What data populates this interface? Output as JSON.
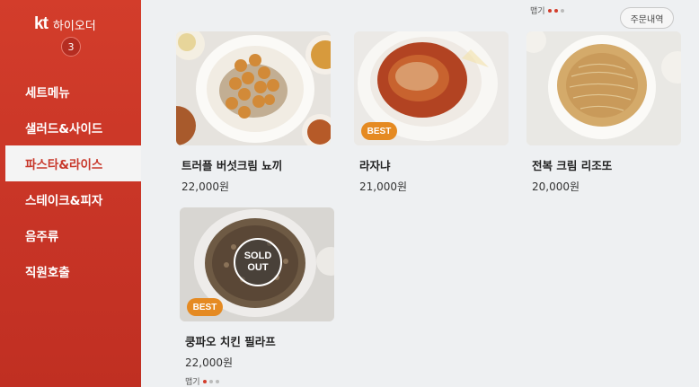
{
  "sidebar": {
    "brand_logo": "kt",
    "brand_name": "하이오더",
    "cart_count": "3",
    "items": [
      {
        "label": "세트메뉴"
      },
      {
        "label": "샐러드&사이드"
      },
      {
        "label": "파스타&라이스",
        "active": true
      },
      {
        "label": "스테이크&피자"
      },
      {
        "label": "음주류"
      },
      {
        "label": "직원호출"
      }
    ]
  },
  "header": {
    "pager_label": "맵기",
    "order_history_label": "주문내역"
  },
  "products": [
    {
      "name": "트러플 버섯크림 뇨끼",
      "price": "22,000원"
    },
    {
      "name": "라자냐",
      "price": "21,000원",
      "badge": "BEST"
    },
    {
      "name": "전복 크림 리조또",
      "price": "20,000원"
    },
    {
      "name": "쿵파오 치킨 필라프",
      "price": "22,000원",
      "badge": "BEST",
      "status_line1": "SOLD",
      "status_line2": "OUT",
      "spice_label": "맵기"
    }
  ],
  "colors": {
    "brand": "#d33d2b",
    "best_badge": "#e58a22"
  }
}
